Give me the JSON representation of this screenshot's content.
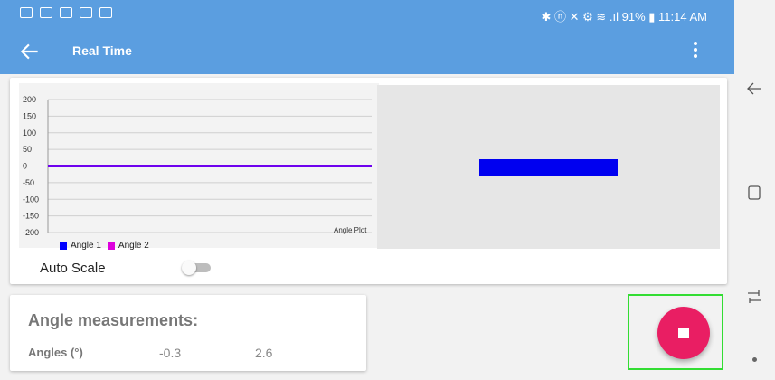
{
  "statusbar": {
    "right_text": "✱ ⓝ ✕ ⚙ ≋ .ıl 91% ▮ 11:14 AM"
  },
  "appbar": {
    "title": "Real Time"
  },
  "plot": {
    "caption": "Angle Plot",
    "legend": [
      {
        "name": "Angle 1",
        "color": "#0000ff"
      },
      {
        "name": "Angle 2",
        "color": "#dd00dd"
      }
    ]
  },
  "chart_data": {
    "type": "line",
    "title": "",
    "xlabel": "",
    "ylabel": "",
    "ylim": [
      -200,
      200
    ],
    "yticks": [
      200,
      150,
      100,
      50,
      0,
      -50,
      -100,
      -150,
      -200
    ],
    "grid": true,
    "legend_position": "bottom-left",
    "series": [
      {
        "name": "Angle 1",
        "color": "#0000ff",
        "values": [
          0,
          0,
          0,
          0,
          0,
          0,
          0,
          0,
          0,
          0
        ]
      },
      {
        "name": "Angle 2",
        "color": "#dd00dd",
        "values": [
          0,
          0,
          0,
          0,
          0,
          0,
          0,
          0,
          0,
          0
        ]
      }
    ]
  },
  "controls": {
    "autoscale_label": "Auto Scale",
    "autoscale_on": false
  },
  "measurements": {
    "heading": "Angle measurements:",
    "label": "Angles (°)",
    "value1": "-0.3",
    "value2": "2.6"
  },
  "colors": {
    "appbar": "#5b9ee0",
    "fab": "#e91e63",
    "highlight": "#33dd33"
  }
}
